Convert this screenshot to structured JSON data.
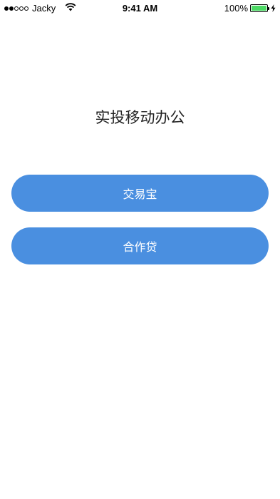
{
  "status_bar": {
    "carrier": "Jacky",
    "time": "9:41 AM",
    "battery_percent": "100%",
    "signal_bars_filled": 2,
    "signal_bars_total": 5,
    "battery_level": 1.0,
    "battery_color": "#4cd964",
    "icons": [
      "signal-dots-icon",
      "wifi-icon",
      "battery-icon",
      "charging-icon"
    ]
  },
  "main": {
    "title": "实投移动办公",
    "buttons": [
      {
        "label": "交易宝"
      },
      {
        "label": "合作贷"
      }
    ],
    "accent_color": "#4a8fe0"
  }
}
